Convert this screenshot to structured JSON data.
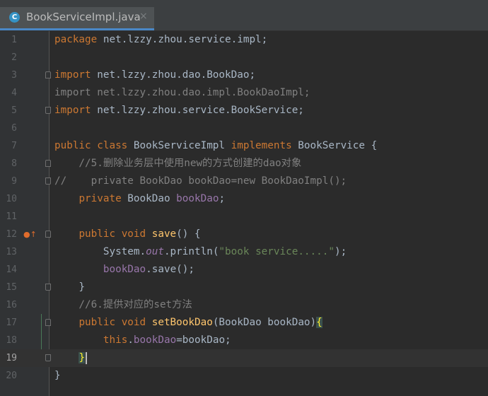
{
  "tab": {
    "icon": "C",
    "title": "BookServiceImpl.java",
    "close": "×"
  },
  "lines": [
    {
      "n": "1",
      "code": "package net.lzzy.zhou.service.impl;"
    },
    {
      "n": "2",
      "code": ""
    },
    {
      "n": "3",
      "code": "import net.lzzy.zhou.dao.BookDao;"
    },
    {
      "n": "4",
      "code": "import net.lzzy.zhou.dao.impl.BookDaoImpl;"
    },
    {
      "n": "5",
      "code": "import net.lzzy.zhou.service.BookService;"
    },
    {
      "n": "6",
      "code": ""
    },
    {
      "n": "7",
      "code": "public class BookServiceImpl implements BookService {"
    },
    {
      "n": "8",
      "code": "    //5.删除业务层中使用new的方式创建的dao对象"
    },
    {
      "n": "9",
      "code": "//    private BookDao bookDao=new BookDaoImpl();"
    },
    {
      "n": "10",
      "code": "    private BookDao bookDao;"
    },
    {
      "n": "11",
      "code": ""
    },
    {
      "n": "12",
      "code": "    public void save() {"
    },
    {
      "n": "13",
      "code": "        System.out.println(\"book service.....\");"
    },
    {
      "n": "14",
      "code": "        bookDao.save();"
    },
    {
      "n": "15",
      "code": "    }"
    },
    {
      "n": "16",
      "code": "    //6.提供对应的set方法"
    },
    {
      "n": "17",
      "code": "    public void setBookDao(BookDao bookDao){"
    },
    {
      "n": "18",
      "code": "        this.bookDao=bookDao;"
    },
    {
      "n": "19",
      "code": "    }"
    },
    {
      "n": "20",
      "code": "}"
    }
  ],
  "icons": {
    "tab_icon": "java-class-icon",
    "implements_marker": "implements-method-icon",
    "fold": "fold-marker-icon"
  },
  "colors": {
    "keyword": "#cc7832",
    "comment": "#808080",
    "field": "#9876aa",
    "method": "#ffc66d",
    "string": "#6a8759",
    "text": "#a9b7c6",
    "background": "#2b2b2b"
  }
}
